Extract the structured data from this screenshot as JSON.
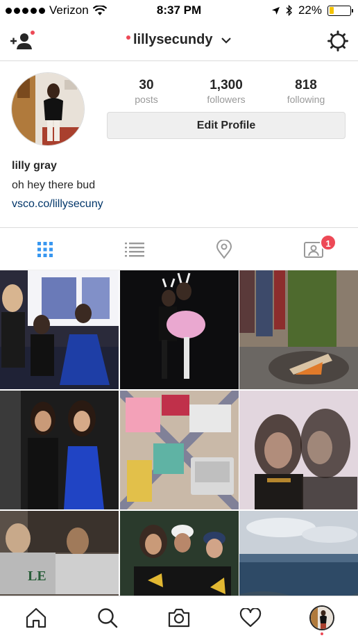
{
  "status_bar": {
    "carrier": "Verizon",
    "time": "8:37 PM",
    "battery_percent": "22%",
    "battery_level": 0.22,
    "battery_color": "#f5c400"
  },
  "header": {
    "username": "lillysecundy",
    "left_icon": "add-user-icon",
    "right_icon": "gear-icon"
  },
  "profile": {
    "stats": [
      {
        "value": "30",
        "label": "posts"
      },
      {
        "value": "1,300",
        "label": "followers"
      },
      {
        "value": "818",
        "label": "following"
      }
    ],
    "edit_button_label": "Edit Profile",
    "name": "lilly gray",
    "bio": "oh hey there bud",
    "link": "vsco.co/lillysecuny"
  },
  "tabs": [
    {
      "name": "grid-view",
      "icon": "grid-icon",
      "active": true
    },
    {
      "name": "list-view",
      "icon": "list-icon",
      "active": false
    },
    {
      "name": "location-view",
      "icon": "location-pin-icon",
      "active": false
    },
    {
      "name": "tagged-view",
      "icon": "tagged-photos-icon",
      "active": false,
      "badge": "1"
    }
  ],
  "bottom_nav": [
    {
      "name": "home",
      "icon": "home-icon"
    },
    {
      "name": "search",
      "icon": "search-icon"
    },
    {
      "name": "camera",
      "icon": "camera-icon"
    },
    {
      "name": "activity",
      "icon": "heart-icon"
    },
    {
      "name": "profile",
      "icon": "profile-avatar"
    }
  ],
  "colors": {
    "accent_blue": "#3897f0",
    "notification_red": "#ed4956",
    "link_blue": "#003569"
  }
}
